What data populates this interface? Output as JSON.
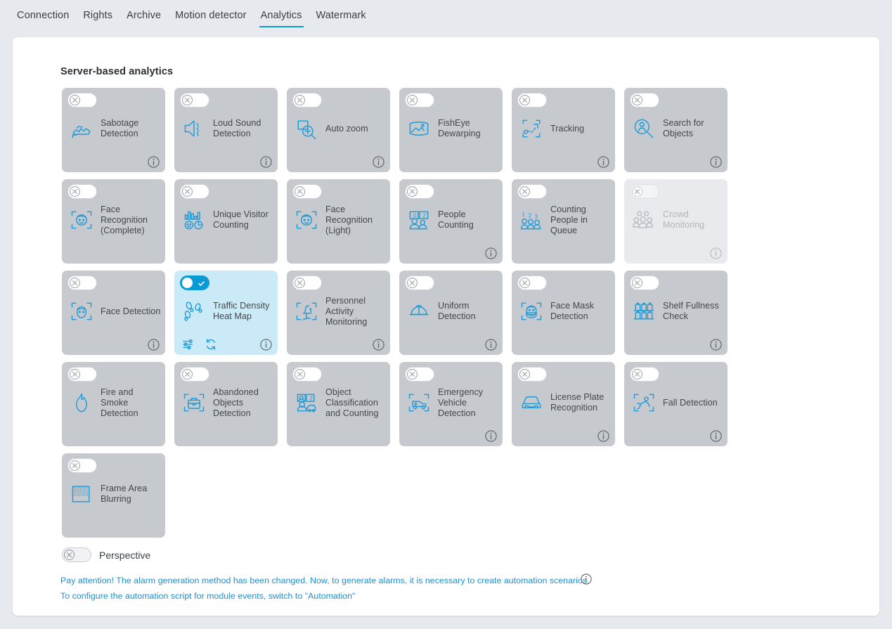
{
  "tabs": [
    {
      "label": "Connection",
      "active": false
    },
    {
      "label": "Rights",
      "active": false
    },
    {
      "label": "Archive",
      "active": false
    },
    {
      "label": "Motion detector",
      "active": false
    },
    {
      "label": "Analytics",
      "active": true
    },
    {
      "label": "Watermark",
      "active": false
    }
  ],
  "section": {
    "title": "Server-based analytics"
  },
  "colors": {
    "accent": "#0a9ad4",
    "icon_blue": "#1f9bd8",
    "card_bg": "#c6c9ce",
    "card_bg_active": "#cbeaf8",
    "card_bg_disabled": "#e8eaee",
    "page_bg": "#e6e9ed",
    "panel_bg": "#ffffff",
    "link": "#1f8fd0"
  },
  "cards": [
    {
      "label": "Sabotage Detection",
      "icon": "sabotage-detection-icon",
      "enabled": false,
      "disabled": false,
      "info": true,
      "actions": []
    },
    {
      "label": "Loud Sound Detection",
      "icon": "loud-sound-icon",
      "enabled": false,
      "disabled": false,
      "info": true,
      "actions": []
    },
    {
      "label": "Auto zoom",
      "icon": "auto-zoom-icon",
      "enabled": false,
      "disabled": false,
      "info": true,
      "actions": []
    },
    {
      "label": "FishEye Dewarping",
      "icon": "fisheye-dewarping-icon",
      "enabled": false,
      "disabled": false,
      "info": false,
      "actions": []
    },
    {
      "label": "Tracking",
      "icon": "tracking-icon",
      "enabled": false,
      "disabled": false,
      "info": true,
      "actions": []
    },
    {
      "label": "Search for Objects",
      "icon": "search-objects-icon",
      "enabled": false,
      "disabled": false,
      "info": true,
      "actions": []
    },
    {
      "label": "Face Recognition (Complete)",
      "icon": "face-recognition-complete-icon",
      "enabled": false,
      "disabled": false,
      "info": false,
      "actions": []
    },
    {
      "label": "Unique Visitor Counting",
      "icon": "unique-visitor-counting-icon",
      "enabled": false,
      "disabled": false,
      "info": false,
      "actions": []
    },
    {
      "label": "Face Recognition (Light)",
      "icon": "face-recognition-light-icon",
      "enabled": false,
      "disabled": false,
      "info": false,
      "actions": []
    },
    {
      "label": "People Counting",
      "icon": "people-counting-icon",
      "enabled": false,
      "disabled": false,
      "info": true,
      "actions": []
    },
    {
      "label": "Counting People in Queue",
      "icon": "counting-people-queue-icon",
      "enabled": false,
      "disabled": false,
      "info": false,
      "actions": []
    },
    {
      "label": "Crowd Monitoring",
      "icon": "crowd-monitoring-icon",
      "enabled": false,
      "disabled": true,
      "info": true,
      "actions": []
    },
    {
      "label": "Face Detection",
      "icon": "face-detection-icon",
      "enabled": false,
      "disabled": false,
      "info": true,
      "actions": []
    },
    {
      "label": "Traffic Density Heat Map",
      "icon": "footsteps-icon",
      "enabled": true,
      "disabled": false,
      "info": true,
      "actions": [
        "settings-sliders-icon",
        "refresh-icon"
      ]
    },
    {
      "label": "Personnel Activity Monitoring",
      "icon": "personnel-activity-icon",
      "enabled": false,
      "disabled": false,
      "info": true,
      "actions": []
    },
    {
      "label": "Uniform Detection",
      "icon": "uniform-detection-icon",
      "enabled": false,
      "disabled": false,
      "info": true,
      "actions": []
    },
    {
      "label": "Face Mask Detection",
      "icon": "face-mask-icon",
      "enabled": false,
      "disabled": false,
      "info": false,
      "actions": []
    },
    {
      "label": "Shelf Fullness Check",
      "icon": "shelf-fullness-icon",
      "enabled": false,
      "disabled": false,
      "info": true,
      "actions": []
    },
    {
      "label": "Fire and Smoke Detection",
      "icon": "fire-smoke-icon",
      "enabled": false,
      "disabled": false,
      "info": false,
      "actions": []
    },
    {
      "label": "Abandoned Objects Detection",
      "icon": "abandoned-objects-icon",
      "enabled": false,
      "disabled": false,
      "info": false,
      "actions": []
    },
    {
      "label": "Object Classification and Counting",
      "icon": "object-classification-icon",
      "enabled": false,
      "disabled": false,
      "info": false,
      "actions": []
    },
    {
      "label": "Emergency Vehicle Detection",
      "icon": "emergency-vehicle-icon",
      "enabled": false,
      "disabled": false,
      "info": true,
      "actions": []
    },
    {
      "label": "License Plate Recognition",
      "icon": "license-plate-icon",
      "enabled": false,
      "disabled": false,
      "info": true,
      "actions": []
    },
    {
      "label": "Fall Detection",
      "icon": "fall-detection-icon",
      "enabled": false,
      "disabled": false,
      "info": true,
      "actions": []
    },
    {
      "label": "Frame Area Blurring",
      "icon": "frame-blurring-icon",
      "enabled": false,
      "disabled": false,
      "info": false,
      "actions": []
    }
  ],
  "perspective": {
    "label": "Perspective",
    "enabled": false
  },
  "notice": {
    "line1": "Pay attention! The alarm generation method has been changed. Now, to generate alarms, it is necessary to create automation scenarios.",
    "line2": "To configure the automation script for module events, switch to \"Automation\"",
    "info_icon": "info-icon"
  }
}
